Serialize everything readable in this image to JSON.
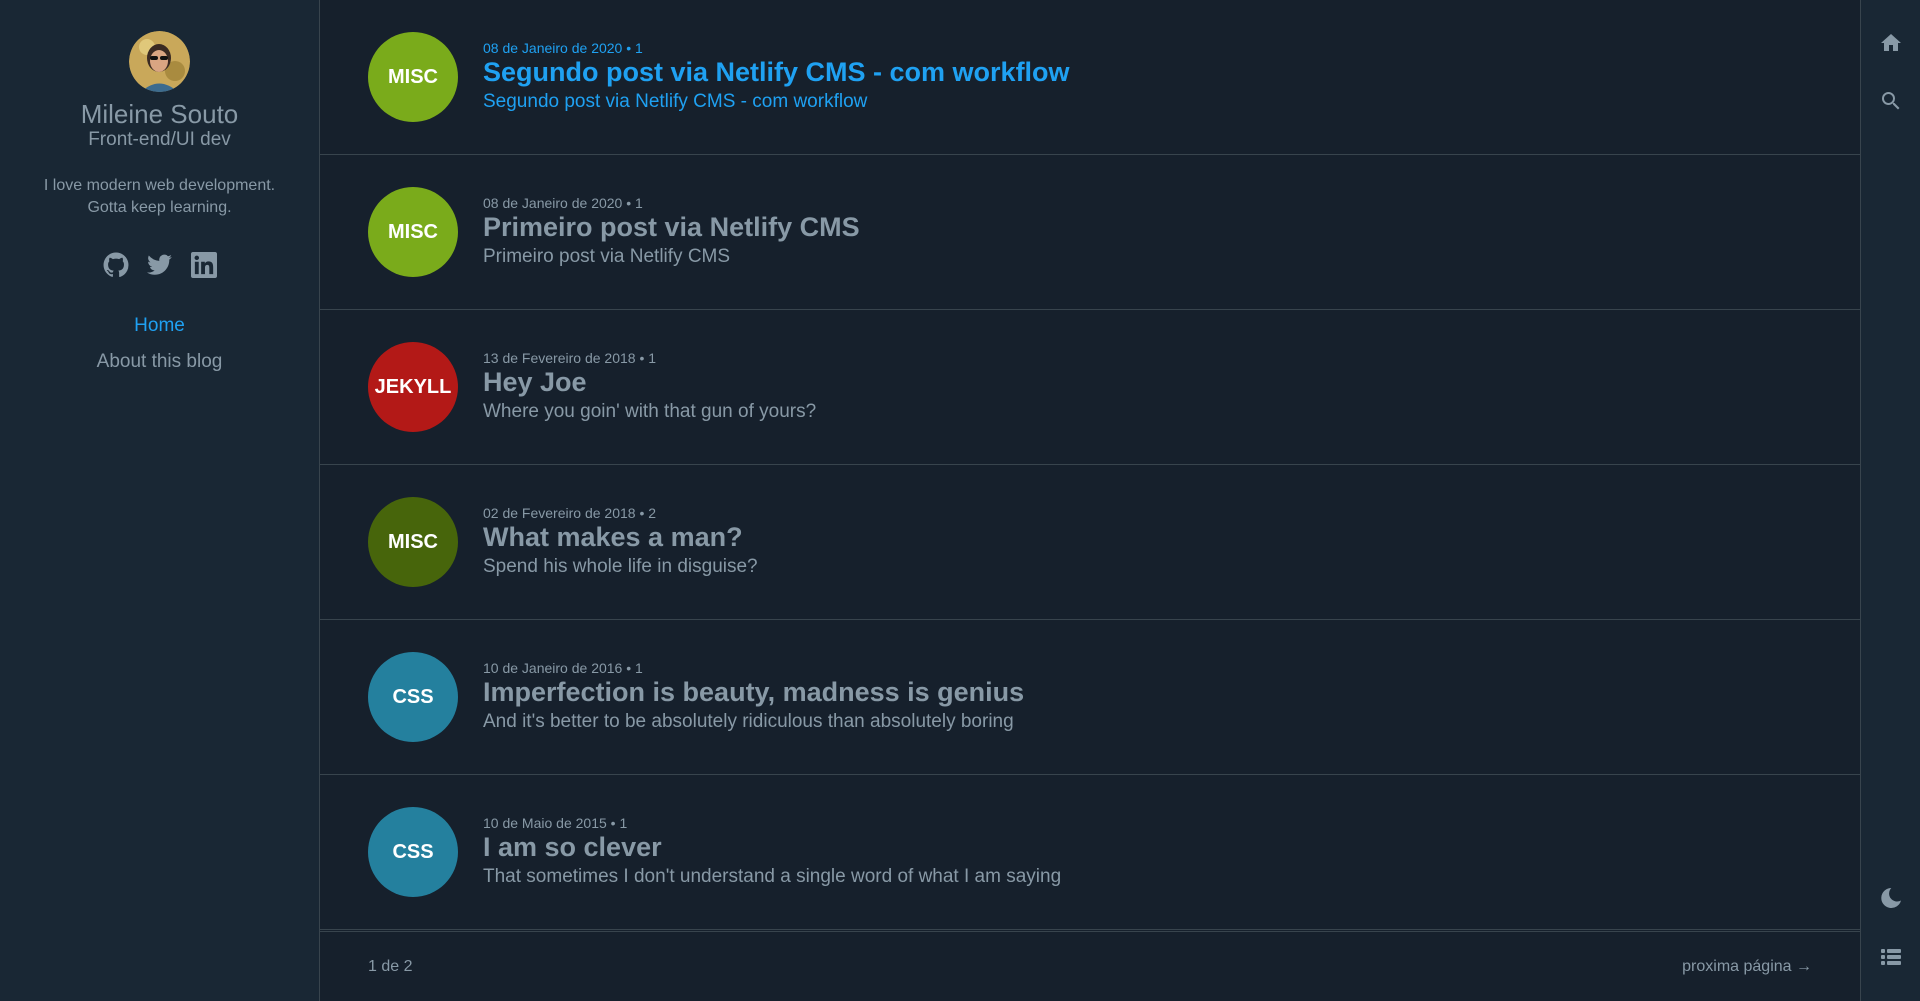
{
  "author": {
    "name": "Mileine Souto",
    "position": "Front-end/UI dev",
    "description_line1": "I love modern web development.",
    "description_line2": "Gotta keep learning."
  },
  "social": [
    "github-icon",
    "twitter-icon",
    "linkedin-icon"
  ],
  "nav": {
    "home": "Home",
    "about": "About this blog"
  },
  "posts": [
    {
      "tag": "MISC",
      "tag_color": "#7aab1b",
      "date": "08 de Janeiro de 2020 • 1",
      "title": "Segundo post via Netlify CMS - com workflow",
      "description": "Segundo post via Netlify CMS - com workflow"
    },
    {
      "tag": "MISC",
      "tag_color": "#7aab1b",
      "date": "08 de Janeiro de 2020 • 1",
      "title": "Primeiro post via Netlify CMS",
      "description": "Primeiro post via Netlify CMS"
    },
    {
      "tag": "JEKYLL",
      "tag_color": "#b31917",
      "date": "13 de Fevereiro de 2018 • 1",
      "title": "Hey Joe",
      "description": "Where you goin' with that gun of yours?"
    },
    {
      "tag": "MISC",
      "tag_color": "#47650b",
      "date": "02 de Fevereiro de 2018 • 2",
      "title": "What makes a man?",
      "description": "Spend his whole life in disguise?"
    },
    {
      "tag": "CSS",
      "tag_color": "#24809e",
      "date": "10 de Janeiro de 2016 • 1",
      "title": "Imperfection is beauty, madness is genius",
      "description": "And it's better to be absolutely ridiculous than absolutely boring"
    },
    {
      "tag": "CSS",
      "tag_color": "#24809e",
      "date": "10 de Maio de 2015 • 1",
      "title": "I am so clever",
      "description": "That sometimes I don't understand a single word of what I am saying"
    }
  ],
  "pagination": {
    "current": "1 de 2",
    "next": "proxima página →"
  },
  "menubar": [
    "home-icon",
    "search-icon",
    "moon-icon",
    "list-icon"
  ],
  "colors": {
    "accent": "#1fa1f2",
    "background": "#16202c",
    "sidebar": "#192734",
    "border": "#38444d",
    "text": "#8899a6"
  }
}
